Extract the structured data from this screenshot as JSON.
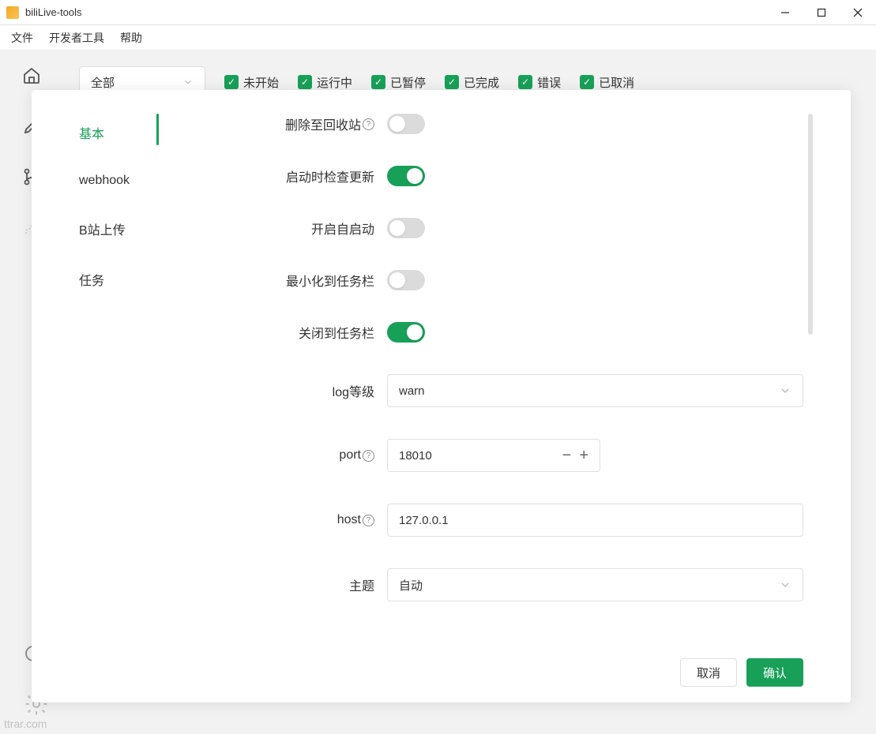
{
  "window": {
    "title": "biliLive-tools"
  },
  "menu": {
    "file": "文件",
    "devtools": "开发者工具",
    "help": "帮助"
  },
  "bg": {
    "filter_all": "全部",
    "filters": [
      "未开始",
      "运行中",
      "已暂停",
      "已完成",
      "错误",
      "已取消"
    ]
  },
  "modal": {
    "tabs": {
      "basic": "基本",
      "webhook": "webhook",
      "upload": "B站上传",
      "task": "任务"
    },
    "form": {
      "delete_to_trash": "删除至回收站",
      "check_update": "启动时检查更新",
      "auto_start": "开启自启动",
      "minimize_to_tray": "最小化到任务栏",
      "close_to_tray": "关闭到任务栏",
      "log_level": "log等级",
      "log_level_value": "warn",
      "port": "port",
      "port_value": "18010",
      "host": "host",
      "host_value": "127.0.0.1",
      "theme": "主题",
      "theme_value": "自动"
    },
    "toggles": {
      "delete_to_trash": false,
      "check_update": true,
      "auto_start": false,
      "minimize_to_tray": false,
      "close_to_tray": true
    },
    "buttons": {
      "cancel": "取消",
      "confirm": "确认"
    }
  },
  "watermark": "ttrar.com"
}
